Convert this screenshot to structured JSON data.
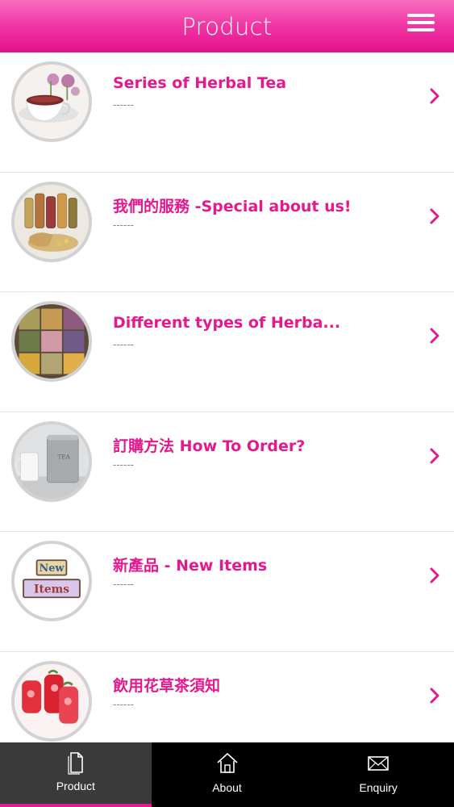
{
  "header": {
    "title": "Product"
  },
  "items": [
    {
      "title": "Series of Herbal Tea",
      "subtitle": "------"
    },
    {
      "title": "我們的服務 -Special about us!",
      "subtitle": "------"
    },
    {
      "title": "Different types of Herba...",
      "subtitle": "------"
    },
    {
      "title": "訂購方法 How To Order?",
      "subtitle": "------"
    },
    {
      "title": "新產品 - New Items",
      "subtitle": "------"
    },
    {
      "title": "飲用花草茶須知",
      "subtitle": "------"
    }
  ],
  "thumb4": {
    "can_label": "TEA"
  },
  "thumb5": {
    "line1": "New",
    "line2": "Items"
  },
  "tabs": [
    {
      "label": "Product",
      "icon": "document-icon",
      "active": true
    },
    {
      "label": "About",
      "icon": "home-icon",
      "active": false
    },
    {
      "label": "Enquiry",
      "icon": "envelope-icon",
      "active": false
    }
  ],
  "colors": {
    "accent": "#e4198f",
    "header_top": "#f86fc0",
    "tabbar": "#000000"
  }
}
